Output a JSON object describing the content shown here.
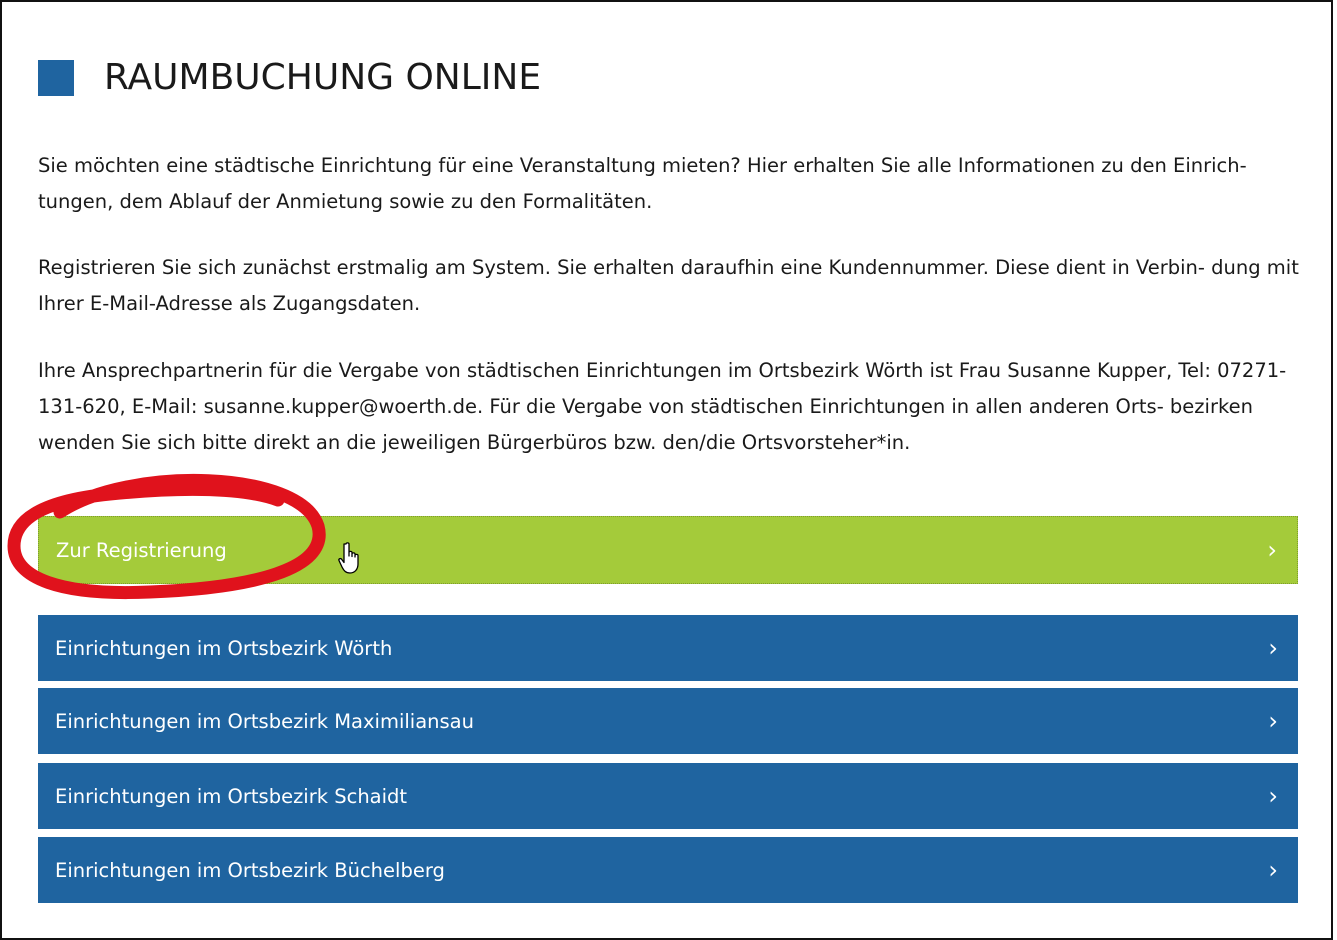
{
  "page": {
    "title": "RAUMBUCHUNG ONLINE"
  },
  "content": {
    "paragraph1": "Sie möchten eine städtische Einrichtung für eine Veranstaltung mieten? Hier erhalten Sie alle Informationen zu den Einrich- tungen, dem Ablauf der Anmietung sowie zu den Formalitäten.",
    "paragraph2": "Registrieren Sie sich zunächst erstmalig am System. Sie erhalten daraufhin eine Kundennummer. Diese dient in Verbin- dung mit Ihrer E-Mail-Adresse als Zugangsdaten.",
    "paragraph3": "Ihre Ansprechpartnerin für die Vergabe von städtischen Einrichtungen im Ortsbezirk Wörth ist Frau Susanne Kupper, Tel: 07271-131-620, E-Mail: susanne.kupper@woerth.de. Für die Vergabe von städtischen Einrichtungen in allen anderen Orts- bezirken wenden Sie sich bitte direkt an die jeweiligen Bürgerbüros bzw. den/die Ortsvorsteher*in."
  },
  "links": [
    {
      "label": "Zur Registrierung",
      "color": "#a4cb3a"
    },
    {
      "label": "Einrichtungen im Ortsbezirk Wörth",
      "color": "#1f64a0"
    },
    {
      "label": "Einrichtungen im Ortsbezirk Maximiliansau",
      "color": "#1f64a0"
    },
    {
      "label": "Einrichtungen im Ortsbezirk Schaidt",
      "color": "#1f64a0"
    },
    {
      "label": "Einrichtungen im Ortsbezirk Büchelberg",
      "color": "#1f64a0"
    }
  ],
  "chevron_glyph": "›",
  "colors": {
    "accent_blue": "#1f64a0",
    "accent_green": "#a4cb3a",
    "annotation_red": "#e0121c"
  },
  "icons": {
    "heading_marker": "blue-square-icon",
    "link_arrow": "chevron-right-icon",
    "cursor": "hand-pointer-icon"
  }
}
